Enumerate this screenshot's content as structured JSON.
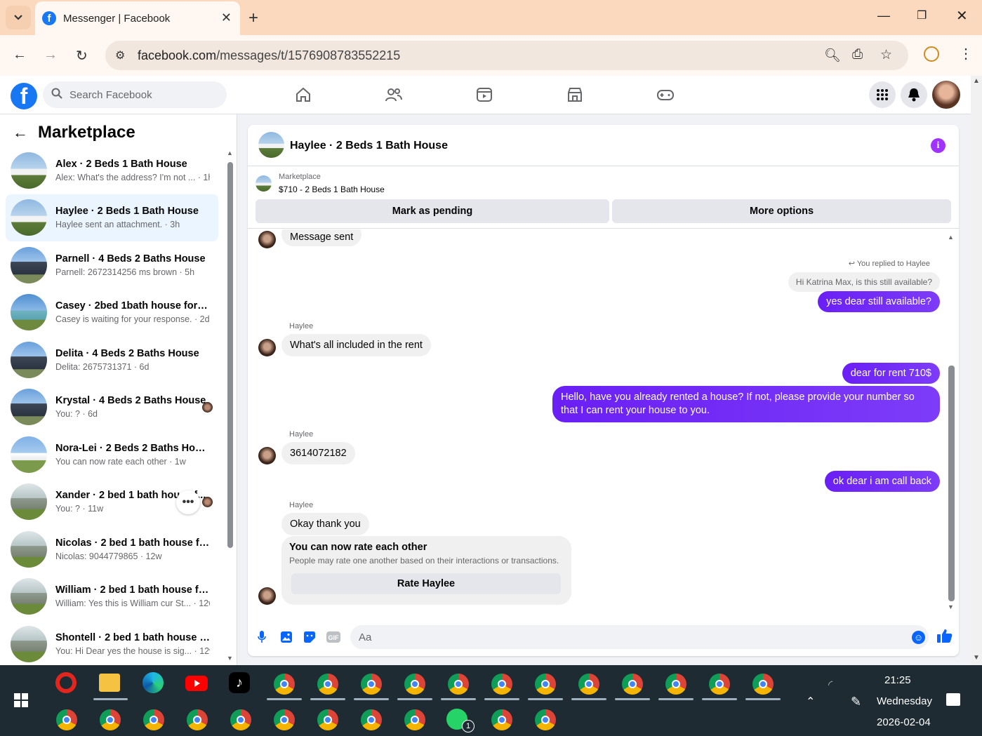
{
  "browser": {
    "tab_title": "Messenger | Facebook",
    "url_domain": "facebook.com",
    "url_path": "/messages/t/1576908783552215"
  },
  "fb": {
    "search_placeholder": "Search Facebook"
  },
  "sidebar": {
    "title": "Marketplace",
    "conversations": [
      {
        "name": "Alex · 2 Beds 1 Bath House",
        "preview": "Alex: What's the address? I'm not ... · 1h",
        "thumb": "house1"
      },
      {
        "name": "Haylee · 2 Beds 1 Bath House",
        "preview": "Haylee sent an attachment. · 3h",
        "thumb": "house1"
      },
      {
        "name": "Parnell · 4 Beds 2 Baths House",
        "preview": "Parnell: 2672314256 ms brown · 5h",
        "thumb": "house2"
      },
      {
        "name": "Casey · 2bed 1bath house for rent",
        "preview": "Casey is waiting for your response. · 2d",
        "thumb": "house3"
      },
      {
        "name": "Delita · 4 Beds 2 Baths House",
        "preview": "Delita: 2675731371 · 6d",
        "thumb": "house2"
      },
      {
        "name": "Krystal · 4 Beds 2 Baths House",
        "preview": "You: ? · 6d",
        "thumb": "house2"
      },
      {
        "name": "Nora-Lei · 2 Beds 2 Baths House",
        "preview": "You can now rate each other · 1w",
        "thumb": "house4"
      },
      {
        "name": "Xander · 2 bed 1 bath house f...",
        "preview": "You: ? · 11w",
        "thumb": "house5"
      },
      {
        "name": "Nicolas · 2 bed 1 bath house for...",
        "preview": "Nicolas: 9044779865 · 12w",
        "thumb": "house5"
      },
      {
        "name": "William · 2 bed 1 bath house for...",
        "preview": "William: Yes this is William cur St... · 12w",
        "thumb": "house5"
      },
      {
        "name": "Shontell · 2 bed 1 bath house fo...",
        "preview": "You: Hi Dear yes the house is sig... · 12w",
        "thumb": "house5"
      }
    ]
  },
  "chat": {
    "title": "Haylee · 2 Beds 1 Bath House",
    "listing_category": "Marketplace",
    "listing_price": "$710 - 2 Beds 1 Bath House",
    "mark_pending": "Mark as pending",
    "more_options": "More options",
    "messages": {
      "sent_partial": "Message sent",
      "replied_label": "You replied to Haylee",
      "quoted": "Hi Katrina Max, is this still available?",
      "out1": "yes dear still available?",
      "sender": "Haylee",
      "in1": "What's all included in the rent",
      "out2": "dear for rent 710$",
      "out3": "Hello, have you already rented a house? If not, please provide your number so that I can rent your house to you.",
      "in2": "3614072182",
      "out4": "ok dear i am call back",
      "in3": "Okay thank you",
      "rate_title": "You can now rate each other",
      "rate_desc": "People may rate one another based on their interactions or transactions.",
      "rate_button": "Rate Haylee"
    },
    "composer_placeholder": "Aa"
  },
  "taskbar": {
    "time": "21:25",
    "day": "Wednesday",
    "date": "2026-02-04",
    "whatsapp_badge": "1"
  }
}
